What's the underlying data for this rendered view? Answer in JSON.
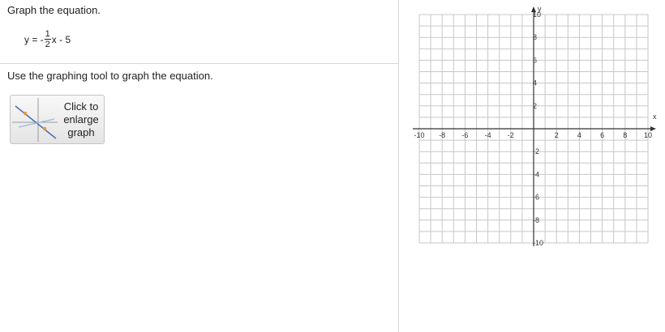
{
  "left": {
    "prompt": "Graph the equation.",
    "equation": {
      "lhs": "y = -",
      "numerator": "1",
      "denominator": "2",
      "rhs": "x - 5"
    },
    "instruction": "Use the graphing tool to graph the equation.",
    "enlarge_button": {
      "label": "Click to\nenlarge\ngraph",
      "icon": "graph-thumbnail-icon"
    }
  },
  "graph": {
    "x_axis_label": "x",
    "y_axis_label": "y",
    "x_range": [
      -10,
      10
    ],
    "y_range": [
      -10,
      10
    ],
    "grid_step": 1,
    "x_tick_labels": [
      "-10",
      "-8",
      "-6",
      "-4",
      "-2",
      "2",
      "4",
      "6",
      "8",
      "10"
    ],
    "y_tick_labels": [
      "10",
      "8",
      "6",
      "4",
      "2",
      "-2",
      "-4",
      "-6",
      "-8",
      "-10"
    ],
    "grid_color": "#c7c7c7",
    "axis_color": "#333333"
  }
}
